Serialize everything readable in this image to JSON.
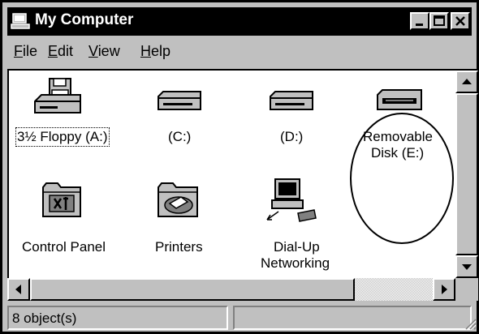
{
  "window": {
    "title": "My Computer"
  },
  "menu": [
    {
      "label": "File",
      "u": "F",
      "rest": "ile"
    },
    {
      "label": "Edit",
      "u": "E",
      "rest": "dit"
    },
    {
      "label": "View",
      "u": "V",
      "rest": "iew"
    },
    {
      "label": "Help",
      "u": "H",
      "rest": "elp"
    }
  ],
  "items": [
    {
      "label": "3½ Floppy (A:)",
      "icon": "floppy-drive-icon"
    },
    {
      "label": "(C:)",
      "icon": "hard-drive-icon"
    },
    {
      "label": "(D:)",
      "icon": "hard-drive-icon"
    },
    {
      "label_line1": "Removable",
      "label_line2": "Disk (E:)",
      "icon": "removable-disk-icon"
    },
    {
      "label": "Control Panel",
      "icon": "control-panel-icon"
    },
    {
      "label": "Printers",
      "icon": "printers-folder-icon"
    },
    {
      "label_line1": "Dial-Up",
      "label_line2": "Networking",
      "icon": "dial-up-networking-icon"
    }
  ],
  "status": {
    "count": "8 object(s)"
  }
}
